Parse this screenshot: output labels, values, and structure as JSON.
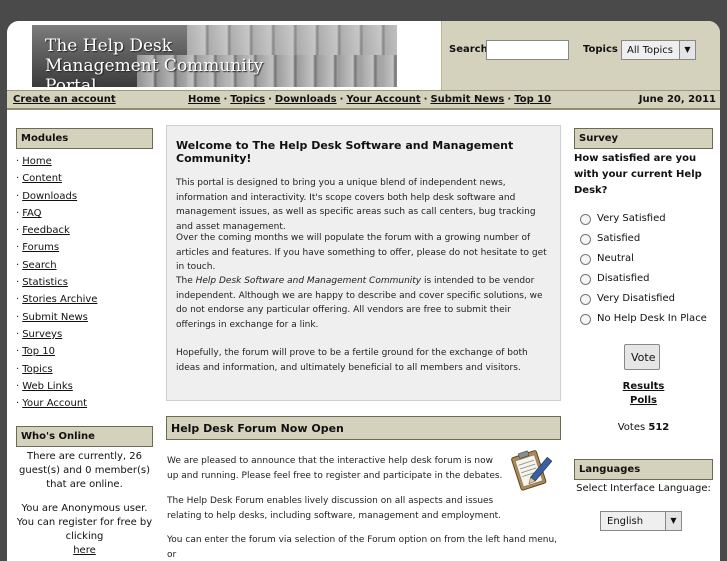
{
  "header": {
    "banner_title": "The Help Desk Management Community Portal",
    "search_label": "Search",
    "search_value": "",
    "topics_label": "Topics",
    "topics_selected": "All Topics"
  },
  "nav": {
    "create_account": "Create an account",
    "links": [
      "Home",
      "Topics",
      "Downloads",
      "Your Account",
      "Submit News",
      "Top 10"
    ],
    "separator": "·",
    "date": "June 20, 2011"
  },
  "modules": {
    "title": "Modules",
    "items": [
      "Home",
      "Content",
      "Downloads",
      "FAQ",
      "Feedback",
      "Forums",
      "Search",
      "Statistics",
      "Stories Archive",
      "Submit News",
      "Surveys",
      "Top 10",
      "Topics",
      "Web Links",
      "Your Account"
    ]
  },
  "whos_online": {
    "title": "Who's Online",
    "text1": "There are currently, 26 guest(s) and 0 member(s) that are online.",
    "text2": "You are Anonymous user. You can register for free by clicking",
    "link": "here"
  },
  "welcome": {
    "title": "Welcome to The Help Desk Software and Management Community!",
    "p1": "This portal is designed to bring you a unique blend of independent news, information and interactivity. It's scope covers both help desk software and management issues, as well as specific areas such as call centers, bug tracking and asset management.",
    "p2": "Over the coming months we will populate the forum with a growing number of articles and features. If you have something to offer, please do not hesitate to get in touch.",
    "p3_prefix": "The ",
    "p3_italic": "Help Desk Software and Management Community",
    "p3_suffix": " is intended to be vendor independent. Although we are happy to describe and cover specific solutions, we do not endorse any particular offering. All vendors are free to submit their offerings in exchange for a link.",
    "p4": "Hopefully, the forum will prove to be a fertile ground for the exchange of both ideas and information, and ultimately beneficial to all members and visitors."
  },
  "forum": {
    "title": "Help Desk Forum Now Open",
    "p1": "We are pleased to announce that the interactive help desk forum is now up and running. Please feel free to register and participate in the debates.",
    "p2": "The Help Desk Forum enables lively discussion on all aspects and issues relating to help desks, including software, management and employment.",
    "p3": "You can enter the forum via selection of the Forum option on from the left hand menu, or"
  },
  "survey": {
    "title": "Survey",
    "question": "How satisfied are you with your current Help Desk?",
    "options": [
      "Very Satisfied",
      "Satisfied",
      "Neutral",
      "Disatisfied",
      "Very Disatisfied",
      "No Help Desk In Place"
    ],
    "vote_label": "Vote",
    "results_label": "Results",
    "polls_label": "Polls",
    "votes_label": "Votes",
    "votes_count": "512"
  },
  "languages": {
    "title": "Languages",
    "prompt": "Select Interface Language:",
    "selected": "English"
  }
}
